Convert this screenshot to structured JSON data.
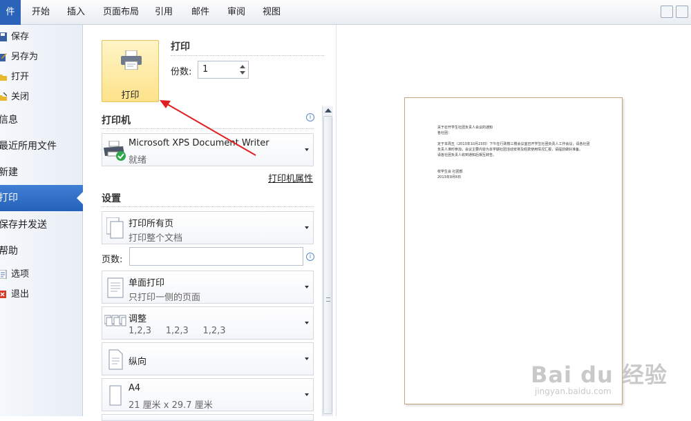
{
  "ribbon": {
    "tabs": [
      "件",
      "开始",
      "插入",
      "页面布局",
      "引用",
      "邮件",
      "审阅",
      "视图"
    ]
  },
  "sidebar": {
    "save": "保存",
    "save_as": "另存为",
    "open": "打开",
    "close": "关闭",
    "info": "信息",
    "recent": "最近所用文件",
    "new": "新建",
    "print": "打印",
    "save_send": "保存并发送",
    "help": "帮助",
    "options": "选项",
    "exit": "退出"
  },
  "print_panel": {
    "print_button": "打印",
    "print_heading": "打印",
    "copies_label": "份数:",
    "copies_value": "1",
    "printer_heading": "打印机",
    "printer_name": "Microsoft XPS Document Writer",
    "printer_status": "就绪",
    "printer_properties": "打印机属性",
    "settings_heading": "设置",
    "print_range_main": "打印所有页",
    "print_range_sub": "打印整个文档",
    "pages_label": "页数:",
    "pages_value": "",
    "sides_main": "单面打印",
    "sides_sub": "只打印一侧的页面",
    "collate_main": "调整",
    "collate_sub": "1,2,3     1,2,3     1,2,3",
    "orientation_main": "纵向",
    "paper_main": "A4",
    "paper_sub": "21 厘米 x 29.7 厘米"
  },
  "preview": {
    "lines": [
      "关于召开学生社团负责人会议的通知",
      "各社团：",
      "定于本周五（2013年10月23日）下午在行政楼三楼会议室召开学生社团负责人工作会议，请各社团",
      "负责人准时参加，会议主要内容为本学期社团活动安排及经费使用情况汇报，请提前做好准备。",
      "请各社团负责人收到通知后相互转告。",
      "校学生会 社团部",
      "2013年9月8日"
    ]
  },
  "watermark": {
    "brand": "Bai du 经验",
    "url": "jingyan.baidu.com"
  },
  "colors": {
    "accent": "#2a63b8",
    "print_button": "#fde28a",
    "arrow": "#e02020"
  }
}
